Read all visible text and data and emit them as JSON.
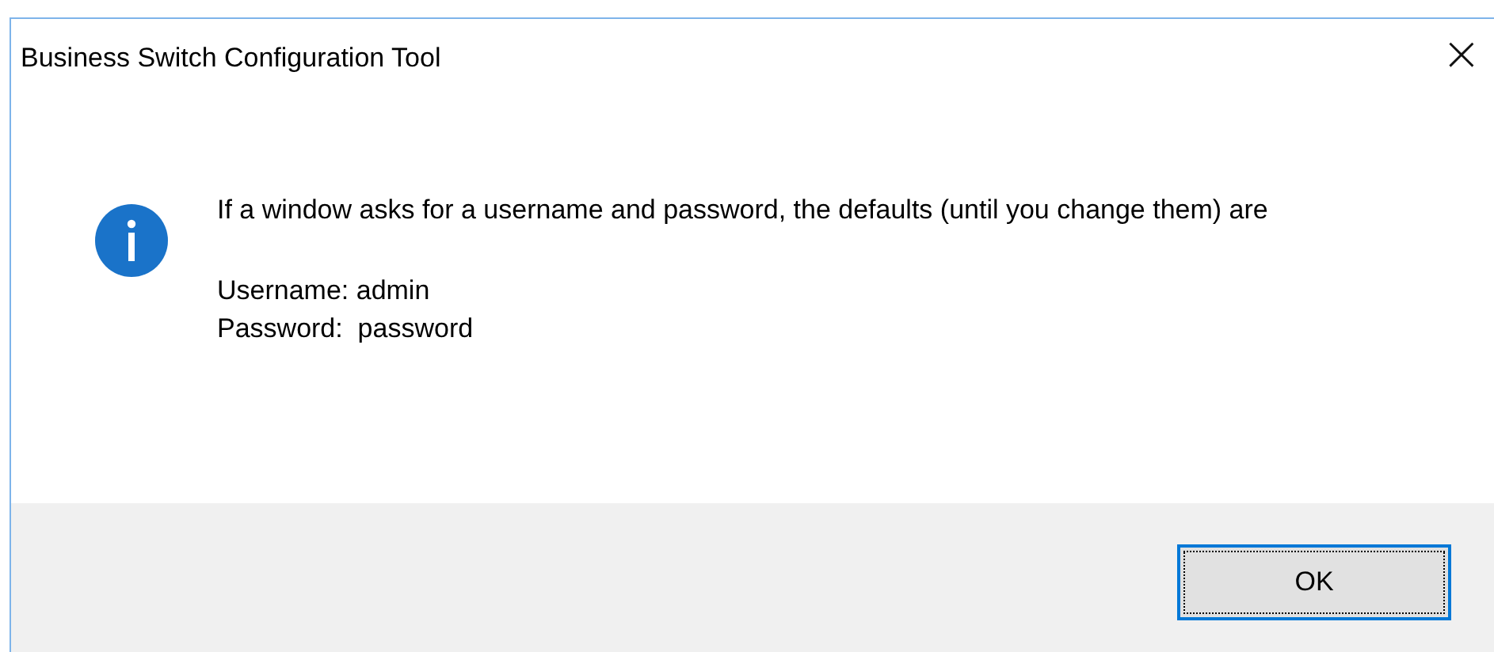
{
  "window": {
    "title": "Business Switch Configuration Tool",
    "close": "×"
  },
  "message": {
    "text": "If a window asks for a username and password, the defaults (until you change them) are",
    "details": [
      "Username: admin",
      "Password:  password"
    ]
  },
  "buttons": [
    {
      "label": "OK",
      "default": true
    }
  ]
}
